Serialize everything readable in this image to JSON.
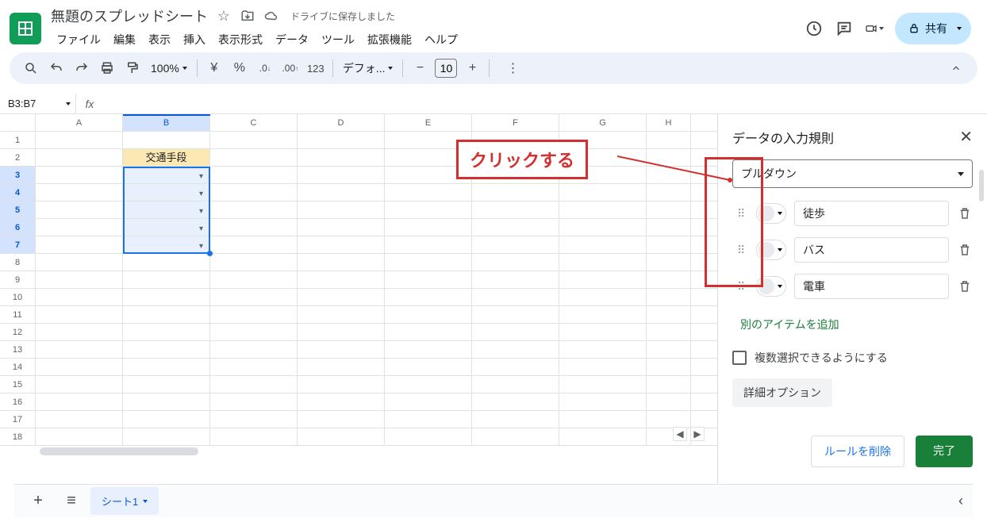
{
  "doc": {
    "title": "無題のスプレッドシート",
    "save_status": "ドライブに保存しました"
  },
  "menus": {
    "file": "ファイル",
    "edit": "編集",
    "view": "表示",
    "insert": "挿入",
    "format": "表示形式",
    "data": "データ",
    "tools": "ツール",
    "extensions": "拡張機能",
    "help": "ヘルプ"
  },
  "share": {
    "label": "共有"
  },
  "toolbar": {
    "zoom": "100%",
    "currency": "¥",
    "percent": "%",
    "dec_dec": ".0",
    "inc_dec": ".00",
    "numfmt": "123",
    "font": "デフォ...",
    "fontsize": "10"
  },
  "namebox": "B3:B7",
  "columns": [
    "A",
    "B",
    "C",
    "D",
    "E",
    "F",
    "G",
    "H"
  ],
  "rows_nums": [
    "1",
    "2",
    "3",
    "4",
    "5",
    "6",
    "7",
    "8",
    "9",
    "10",
    "11",
    "12",
    "13",
    "14",
    "15",
    "16",
    "17",
    "18"
  ],
  "cell_b2": "交通手段",
  "sheet_tab": "シート1",
  "sidebar": {
    "title": "データの入力規則",
    "criteria": "プルダウン",
    "items": [
      "徒歩",
      "バス",
      "電車"
    ],
    "add_item": "別のアイテムを追加",
    "multi_select": "複数選択できるようにする",
    "advanced": "詳細オプション",
    "delete_rule": "ルールを削除",
    "done": "完了"
  },
  "annotation": {
    "label": "クリックする"
  }
}
